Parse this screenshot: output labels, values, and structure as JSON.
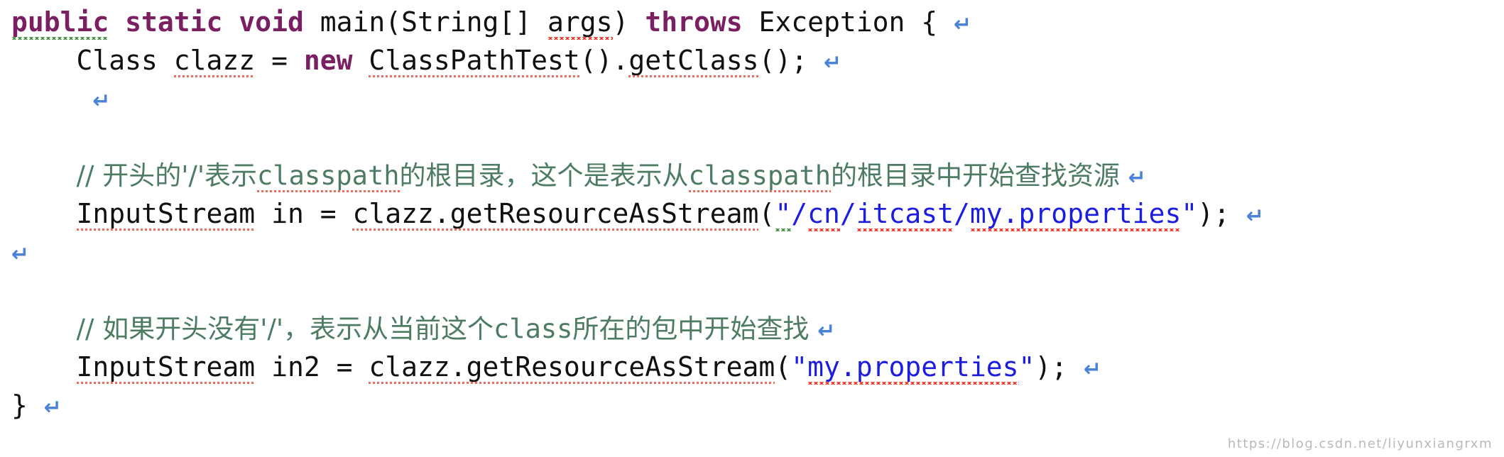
{
  "editor": {
    "language": "Java",
    "background_color": "#ffffff",
    "colors": {
      "keyword": "#7b1f63",
      "plain_text": "#101010",
      "comment": "#4d7c63",
      "string_literal": "#1d1de0",
      "line_end_marker": "#4a83d8",
      "spellcheck_squiggle_red": "#e53b2e",
      "inspection_squiggle_green": "#3f8f3f",
      "watermark": "#b9b9b9"
    },
    "eol_marker_glyph": "↵"
  },
  "code": {
    "lines": [
      {
        "id": "line-1",
        "indent": "",
        "tokens": [
          {
            "text": "public",
            "kind": "keyword",
            "underline": "green-squiggle"
          },
          {
            "text": " ",
            "kind": "plain",
            "underline": "none"
          },
          {
            "text": "static",
            "kind": "keyword",
            "underline": "none"
          },
          {
            "text": " ",
            "kind": "plain",
            "underline": "none"
          },
          {
            "text": "void",
            "kind": "keyword",
            "underline": "none"
          },
          {
            "text": " main(String[] ",
            "kind": "plain",
            "underline": "none"
          },
          {
            "text": "args",
            "kind": "plain",
            "underline": "red-squiggle"
          },
          {
            "text": ") ",
            "kind": "plain",
            "underline": "none"
          },
          {
            "text": "throws",
            "kind": "keyword",
            "underline": "none"
          },
          {
            "text": " Exception { ",
            "kind": "plain",
            "underline": "none"
          },
          {
            "text": "↵",
            "kind": "eol",
            "underline": "none"
          }
        ]
      },
      {
        "id": "line-2",
        "indent": "    ",
        "tokens": [
          {
            "text": "Class ",
            "kind": "plain",
            "underline": "none"
          },
          {
            "text": "clazz",
            "kind": "plain",
            "underline": "red-dotted"
          },
          {
            "text": " = ",
            "kind": "plain",
            "underline": "none"
          },
          {
            "text": "new",
            "kind": "keyword",
            "underline": "none"
          },
          {
            "text": " ",
            "kind": "plain",
            "underline": "none"
          },
          {
            "text": "ClassPathTest",
            "kind": "plain",
            "underline": "red-dotted"
          },
          {
            "text": "().",
            "kind": "plain",
            "underline": "none"
          },
          {
            "text": "getClass",
            "kind": "plain",
            "underline": "red-dotted"
          },
          {
            "text": "(); ",
            "kind": "plain",
            "underline": "none"
          },
          {
            "text": "↵",
            "kind": "eol",
            "underline": "none"
          }
        ]
      },
      {
        "id": "line-3",
        "indent": "     ",
        "tokens": [
          {
            "text": "↵",
            "kind": "eol",
            "underline": "none"
          }
        ]
      },
      {
        "id": "line-4",
        "indent": "    ",
        "tokens": []
      },
      {
        "id": "line-5",
        "indent": "    ",
        "tokens": [
          {
            "text": "// 开头的'/'表示",
            "kind": "comment",
            "underline": "none"
          },
          {
            "text": "classpath",
            "kind": "comment-mono",
            "underline": "red-dotted"
          },
          {
            "text": "的根目录，这个是表示从",
            "kind": "comment",
            "underline": "none"
          },
          {
            "text": "classpath",
            "kind": "comment-mono",
            "underline": "red-dotted"
          },
          {
            "text": "的根目录中开始查找资源 ",
            "kind": "comment",
            "underline": "none"
          },
          {
            "text": "↵",
            "kind": "eol",
            "underline": "none"
          }
        ]
      },
      {
        "id": "line-6",
        "indent": "    ",
        "tokens": [
          {
            "text": "InputStream",
            "kind": "plain",
            "underline": "red-dotted"
          },
          {
            "text": " in = ",
            "kind": "plain",
            "underline": "none"
          },
          {
            "text": "clazz.getResourceAsStream",
            "kind": "plain",
            "underline": "red-dotted"
          },
          {
            "text": "(",
            "kind": "plain",
            "underline": "none"
          },
          {
            "text": "\"",
            "kind": "string",
            "underline": "green-squiggle"
          },
          {
            "text": "/",
            "kind": "string",
            "underline": "none"
          },
          {
            "text": "cn",
            "kind": "string",
            "underline": "red-squiggle"
          },
          {
            "text": "/",
            "kind": "string",
            "underline": "none"
          },
          {
            "text": "itcast",
            "kind": "string",
            "underline": "red-squiggle"
          },
          {
            "text": "/",
            "kind": "string",
            "underline": "none"
          },
          {
            "text": "my.properties",
            "kind": "string",
            "underline": "red-squiggle"
          },
          {
            "text": "\"",
            "kind": "string",
            "underline": "none"
          },
          {
            "text": "); ",
            "kind": "plain",
            "underline": "none"
          },
          {
            "text": "↵",
            "kind": "eol",
            "underline": "none"
          }
        ]
      },
      {
        "id": "line-7",
        "indent": "",
        "tokens": [
          {
            "text": "↵",
            "kind": "eol",
            "underline": "none"
          }
        ]
      },
      {
        "id": "line-8",
        "indent": "    ",
        "tokens": []
      },
      {
        "id": "line-9",
        "indent": "    ",
        "tokens": [
          {
            "text": "// 如果开头没有'/'，表示从当前这个",
            "kind": "comment",
            "underline": "none"
          },
          {
            "text": "class",
            "kind": "comment-mono",
            "underline": "none"
          },
          {
            "text": "所在的包中开始查找 ",
            "kind": "comment",
            "underline": "none"
          },
          {
            "text": "↵",
            "kind": "eol",
            "underline": "none"
          }
        ]
      },
      {
        "id": "line-10",
        "indent": "    ",
        "tokens": [
          {
            "text": "InputStream",
            "kind": "plain",
            "underline": "red-dotted"
          },
          {
            "text": " in2 = ",
            "kind": "plain",
            "underline": "none"
          },
          {
            "text": "clazz.getResourceAsStream",
            "kind": "plain",
            "underline": "red-dotted"
          },
          {
            "text": "(",
            "kind": "plain",
            "underline": "none"
          },
          {
            "text": "\"",
            "kind": "string",
            "underline": "none"
          },
          {
            "text": "my.properties",
            "kind": "string",
            "underline": "red-squiggle"
          },
          {
            "text": "\"",
            "kind": "string",
            "underline": "none"
          },
          {
            "text": "); ",
            "kind": "plain",
            "underline": "none"
          },
          {
            "text": "↵",
            "kind": "eol",
            "underline": "none"
          }
        ]
      },
      {
        "id": "line-11",
        "indent": "",
        "tokens": [
          {
            "text": "} ",
            "kind": "plain",
            "underline": "none"
          },
          {
            "text": "↵",
            "kind": "eol",
            "underline": "none"
          }
        ]
      }
    ]
  },
  "watermark": {
    "text": "https://blog.csdn.net/liyunxiangrxm"
  }
}
